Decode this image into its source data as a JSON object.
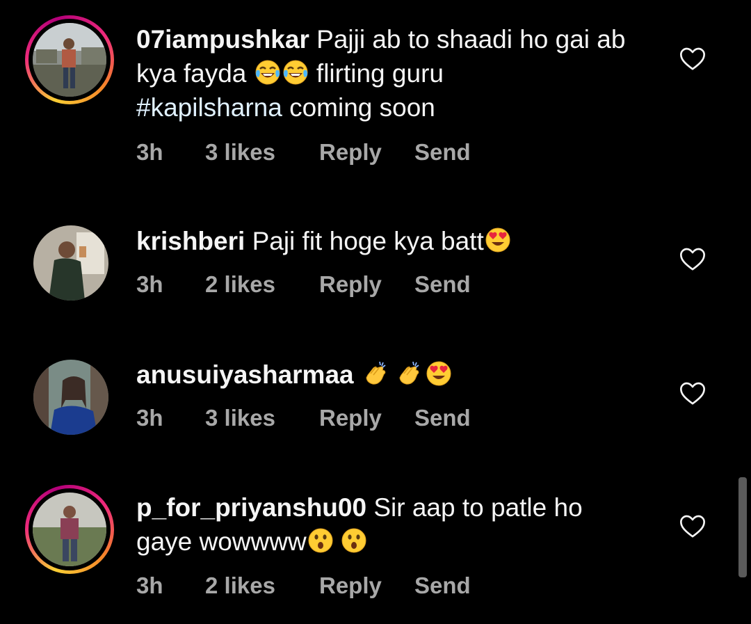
{
  "comments": [
    {
      "username": "07iampushkar",
      "text_parts": [
        " Pajji ab to shaadi ho gai ab kya fayda ",
        " flirting guru ",
        " coming soon"
      ],
      "hashtag": "#kapilsharna",
      "emojis": [
        "joy-emoji",
        "joy-emoji"
      ],
      "time": "3h",
      "likes": "3 likes",
      "reply": "Reply",
      "send": "Send",
      "story_ring": true
    },
    {
      "username": "krishberi",
      "text": " Paji fit hoge kya batt",
      "emojis": [
        "heart-eyes-emoji"
      ],
      "time": "3h",
      "likes": "2 likes",
      "reply": "Reply",
      "send": "Send",
      "story_ring": false
    },
    {
      "username": "anusuiyasharmaa",
      "text": " ",
      "emojis": [
        "clapping-hands-emoji",
        "clapping-hands-emoji",
        "heart-eyes-emoji"
      ],
      "time": "3h",
      "likes": "3 likes",
      "reply": "Reply",
      "send": "Send",
      "story_ring": false
    },
    {
      "username": "p_for_priyanshu00",
      "text_parts": [
        " Sir aap to patle ho",
        "gaye wowwww"
      ],
      "emojis": [
        "astonished-emoji",
        "astonished-emoji"
      ],
      "time": "3h",
      "likes": "2 likes",
      "reply": "Reply",
      "send": "Send",
      "story_ring": true
    }
  ],
  "icons": {
    "like": "heart-outline-icon"
  },
  "colors": {
    "background": "#000000",
    "text": "#f5f5f5",
    "meta": "#a8a8a8",
    "hashtag": "#e0f1ff"
  }
}
